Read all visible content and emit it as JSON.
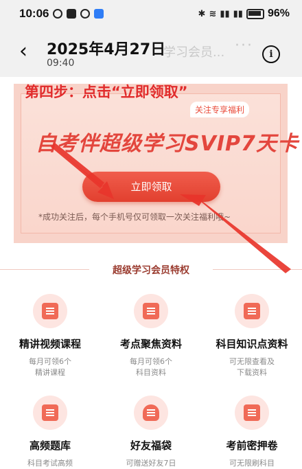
{
  "status_bar": {
    "time": "10:06",
    "battery": "96%"
  },
  "header": {
    "date": "2025年4月27日",
    "time": "09:40",
    "bg_title": "学习会员...",
    "more": "···"
  },
  "banner": {
    "step_text": "第四步：点击“立即领取”",
    "follow_tag": "关注专享福利",
    "promo_title": "自考伴超级学习SVIP7天卡",
    "claim_button": "立即领取",
    "note": "*成功关注后，每个手机号仅可领取一次关注福利哦~"
  },
  "section_title": "超级学习会员特权",
  "features": [
    {
      "name": "精讲视频课程",
      "desc1": "每月可领6个",
      "desc2": "精讲课程"
    },
    {
      "name": "考点聚焦资料",
      "desc1": "每月可领6个",
      "desc2": "科目资料"
    },
    {
      "name": "科目知识点资料",
      "desc1": "可无限查看及",
      "desc2": "下载资料"
    },
    {
      "name": "高频题库",
      "desc1": "科目考试高频",
      "desc2": ""
    },
    {
      "name": "好友福袋",
      "desc1": "可赠送好友7日",
      "desc2": ""
    },
    {
      "name": "考前密押卷",
      "desc1": "可无限刷科目",
      "desc2": ""
    }
  ],
  "colors": {
    "accent": "#e12c2c",
    "button": "#ea4c3b",
    "banner_bg": "#f8d3c9"
  },
  "icons": [
    "video-icon",
    "document-check-icon",
    "notes-icon",
    "question-bank-icon",
    "gift-bag-icon",
    "exam-paper-icon"
  ]
}
